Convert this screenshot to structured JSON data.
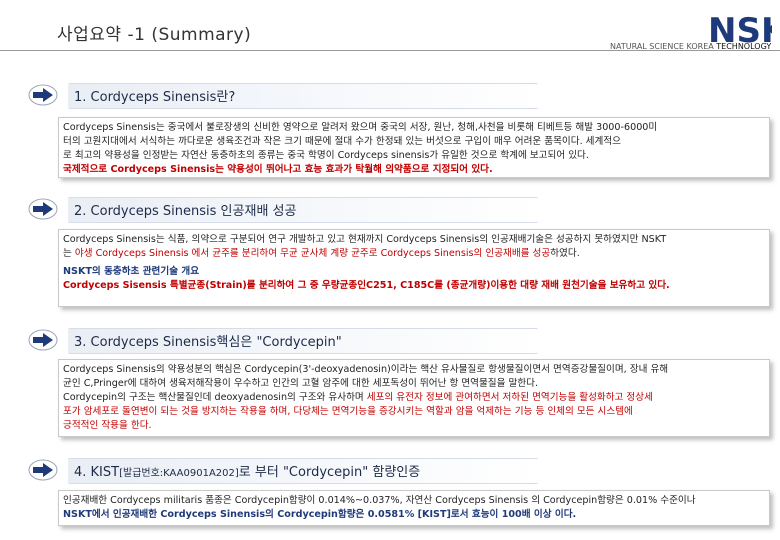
{
  "header": {
    "title": "사업요약 -1 (Summary)",
    "logo_letters": "NSK",
    "logo_tagline_pre": "NATURAL SCIENCE KOREA",
    "logo_tagline_post": "TECHNOLOGY"
  },
  "sections": [
    {
      "title": "1. Cordyceps Sinensis란?",
      "lines": [
        "Cordyceps Sinensis는 중국에서 불로장생의 신비한 영약으로 알려저 왔으며 중국의 서장, 원난, 청해,사천을 비롯해 티베트등 해발 3000-6000미",
        "터의 고원지대에서 서식하는 까다로운 생육조건과 작은 크기 때문에 절대 수가 한정돼 있는 버섯으로 구입이 매우 어려운 품목이다. 세계적으",
        "로 최고의 약용성을 인정받는 자연산 동충하초의 종류는 중국 학명이 Cordyceps sinensis가 유일한 것으로 학계에 보고되어 있다."
      ],
      "highlight": "국제적으로 Cordyceps Sinensis는 약용성이 뛰어나고 효능 효과가 탁월해 의약품으로 지정되어 있다."
    },
    {
      "title": "2. Cordyceps Sinensis 인공재배 성공",
      "line1": "Cordyceps Sinensis는  식품, 의약으로 구분되어 연구 개발하고 있고 현재까지 Cordyceps Sinensis의 인공재배기술은 성공하지 못하였지만 NSKT",
      "line2_pre": "는 ",
      "line2_red": "야생 Cordyceps Sinensis 에서 균주를 분리하여 무균 균사체 계량 균주로 Cordyceps Sinensis의 인공재배를 성공",
      "line2_post": "하였다.",
      "subheading": "NSKT의 동충하초 관련기술 개요",
      "subtext": "Cordyceps Sisensis 특별균종(Strain)를 분리하여 그 중 우량균종인C251, C185C를 (종균개량)이용한 대량 재배 원천기술을 보유하고 있다."
    },
    {
      "title": "3. Cordyceps Sinensis핵심은 \"Cordycepin\"",
      "lines": [
        "Cordyceps Sinensis의 약용성분의 핵심은 Cordycepin(3'-deoxyadenosin)이라는 핵산 유사물질로 항생물질이면서 면역증강물질이며, 장내 유해",
        "균인 C,Pringer에 대하여 생육저해작용이 우수하고 인간의 고혈 암주에 대한 세포독성이 뛰어난 항 면역물질을 말한다."
      ],
      "line3_pre": "Cordycepin의 구조는 핵산물질인데 deoxyadenosin의 구조와 유사하며 ",
      "line3_red": "세포의 유전자 정보에 관여하면서 저하된 면역기능을 활성화하고 정상세",
      "line4_red": "포가 암세포로 돌연변이 되는 것을 방지하는 작용을 하며, 다당체는 면역기능을 증강시키는 역할과 암을 억제하는 기능 등 인체의 모든 시스템에",
      "line5_red": "긍적적인 작용을 한다."
    },
    {
      "title_pre": "4. KIST",
      "title_small": "[발급번호:KAA0901A202]",
      "title_post": "로 부터 \"Cordycepin\" 함량인증",
      "line1": "인공재배한 Cordyceps militaris 품종은 Cordycepin함량이 0.014%~0.037%, 자연산 Cordyceps Sinensis 의 Cordycepin함량은 0.01% 수준이나",
      "line2": "NSKT에서 인공재배한 Cordyceps Sinensis의 Cordycepin함량은 0.0581% [KIST]로서 효능이 100배 이상 이다."
    }
  ],
  "colors": {
    "accent_red": "#c00000",
    "navy": "#1f3a7a",
    "arrow_blue": "#1f3a7a"
  }
}
